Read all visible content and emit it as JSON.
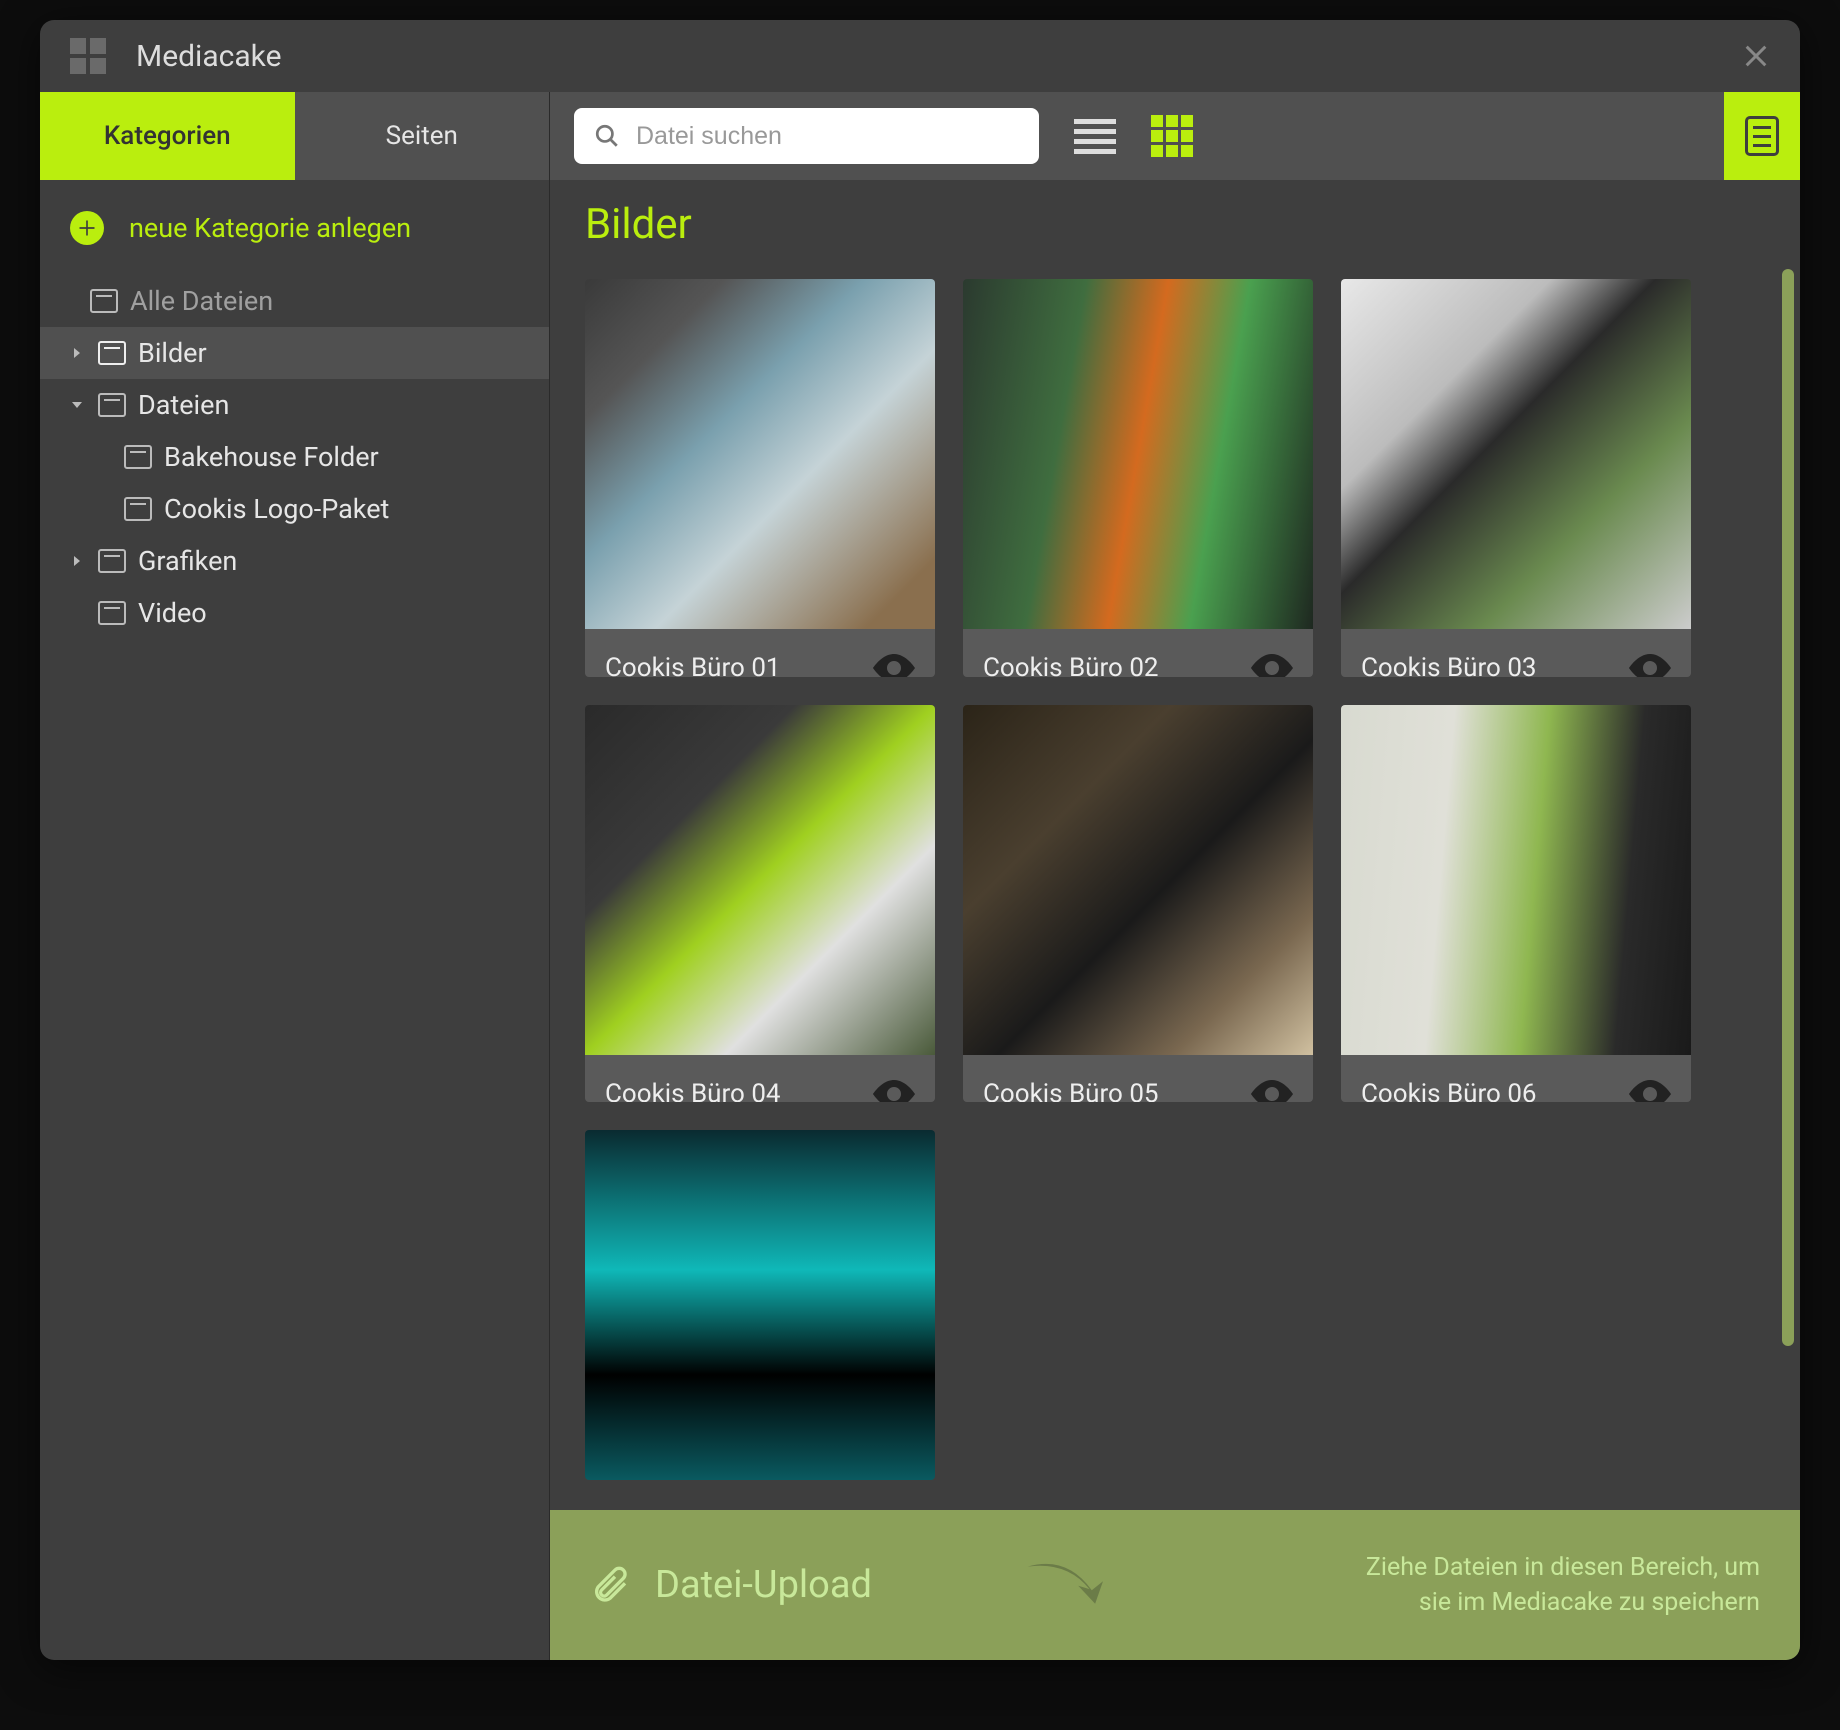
{
  "app": {
    "title": "Mediacake"
  },
  "sidebar": {
    "tabs": {
      "categories": "Kategorien",
      "pages": "Seiten"
    },
    "new_category": "neue Kategorie anlegen",
    "tree": {
      "all_files": "Alle Dateien",
      "items": [
        {
          "label": "Bilder"
        },
        {
          "label": "Dateien",
          "children": [
            {
              "label": "Bakehouse Folder"
            },
            {
              "label": "Cookis Logo-Paket"
            }
          ]
        },
        {
          "label": "Grafiken"
        },
        {
          "label": "Video"
        }
      ]
    }
  },
  "toolbar": {
    "search_placeholder": "Datei suchen"
  },
  "content": {
    "heading": "Bilder",
    "cards": [
      {
        "title": "Cookis Büro 01"
      },
      {
        "title": "Cookis Büro 02"
      },
      {
        "title": "Cookis Büro 03"
      },
      {
        "title": "Cookis Büro 04"
      },
      {
        "title": "Cookis Büro 05"
      },
      {
        "title": "Cookis Büro 06"
      }
    ]
  },
  "upload": {
    "label": "Datei-Upload",
    "desc_line1": "Ziehe Dateien in diesen Bereich, um",
    "desc_line2": "sie im Mediacake zu speichern"
  }
}
